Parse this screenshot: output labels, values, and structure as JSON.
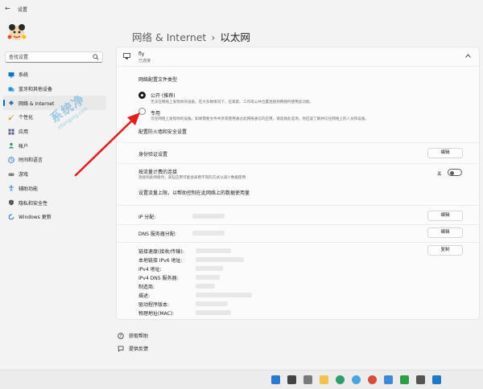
{
  "window": {
    "title": "设置"
  },
  "search": {
    "placeholder": "查找设置"
  },
  "sidebar": {
    "items": [
      {
        "label": "系统",
        "color": "#0a74c9"
      },
      {
        "label": "蓝牙和其他设备",
        "color": "#2a8fd8"
      },
      {
        "label": "网络 & Internet",
        "color": "#3b6fb0"
      },
      {
        "label": "个性化",
        "color": "#c98a2c"
      },
      {
        "label": "应用",
        "color": "#5c5c8a"
      },
      {
        "label": "帐户",
        "color": "#2f9e6a"
      },
      {
        "label": "时间和语言",
        "color": "#3b7fd1"
      },
      {
        "label": "游戏",
        "color": "#6b6b6b"
      },
      {
        "label": "辅助功能",
        "color": "#3d8ad6"
      },
      {
        "label": "隐私和安全性",
        "color": "#5a5a5a"
      },
      {
        "label": "Windows 更新",
        "color": "#1f78c8"
      }
    ],
    "active_index": 2
  },
  "header": {
    "crumb": "网络 & Internet",
    "separator": "›",
    "current": "以太网"
  },
  "connection": {
    "name": "fly",
    "status": "已连接"
  },
  "profile": {
    "heading": "网络配置文件类型",
    "public_label": "公开 (推荐)",
    "public_desc": "无法在网络上发现你的设备。在大多数情况下，在家庭、工作或公共位置连接到网络时使用此功能。",
    "private_label": "专用",
    "private_desc": "可在网络上发现你的设备。如果需要文件共享或使用通过此网络通信的应用，请选择此选项。你应该了解并信任网络上的人员和设备。",
    "firewall_link": "配置防火墙和安全设置"
  },
  "auth": {
    "label": "身份验证设置",
    "button": "编辑"
  },
  "metered": {
    "label": "按流量计费的连接",
    "desc": "连接到此网络时，某些应用可能会采用不同的方式以减少数据使用",
    "toggle_state": "关",
    "data_limit_link": "设置流量上限，以帮助控制在此网络上的数据使用量"
  },
  "ip": {
    "label": "IP 分配:",
    "button": "编辑"
  },
  "dns": {
    "label": "DNS 服务器分配:",
    "button": "编辑"
  },
  "props": {
    "labels": [
      "链接速度(接收/传输):",
      "本地链接 IPv6 地址:",
      "IPv4 地址:",
      "IPv4 DNS 服务器:",
      "制造商:",
      "描述:",
      "驱动程序版本:",
      "物理地址(MAC):"
    ],
    "copy_button": "复制"
  },
  "help": {
    "get_help": "获取帮助",
    "feedback": "提供反馈"
  },
  "watermark": {
    "logo": "系统净",
    "url": "xitongjing.com"
  },
  "colors": {
    "accent": "#0067c0",
    "arrow": "#e02020"
  }
}
